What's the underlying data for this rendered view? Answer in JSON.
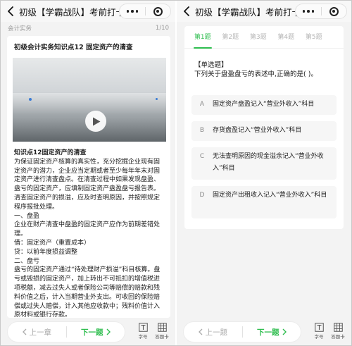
{
  "left": {
    "title": "初级【学霸战队】考前打卡...",
    "subheader": {
      "category": "会计实务",
      "progress": "1/10"
    },
    "card_title": "初级会计实务知识点12 固定资产的清查",
    "content_lines": [
      "知识点12固定资产的清查",
      "为保证固定资产核算的真实性，充分挖掘企业现有固",
      "定资产的潜力，企业应当定期或者至少每年年末对固",
      "定资产进行清查盘点。在清查过程中如果发现盘盈、",
      "盘亏的固定资产，应填制固定资产盘盈盘亏报告表。",
      "清查固定资产的损溢，应及时查明原因，并按照规定",
      "程序报批处理。",
      "一、盘盈",
      "企业在财产清查中盘盈的固定资产应作为前期差错处",
      "理。",
      "借：固定资产（重置成本）",
      "贷：以前年度损益调整",
      "二、盘亏",
      "盘亏的固定资产通过“待处理财产损溢”科目核算。盘",
      "亏或毁损的固定资产，加上转出不可抵扣的增值税进",
      "项税额，减去过失人或者保险公司等赔偿的赔款和残",
      "料价值之后，计入当期营业外支出。可收回的保险赔",
      "偿或过失人赔偿，计入其他应收款中；残料价值计入",
      "原材料或银行存款。"
    ],
    "nav": {
      "prev": "上一章",
      "next": "下一题"
    },
    "tools": {
      "font": "字号",
      "sheet": "答题卡"
    }
  },
  "right": {
    "title": "初级【学霸战队】考前打卡...",
    "tabs": [
      "第1题",
      "第2题",
      "第3题",
      "第4题",
      "第5题"
    ],
    "question_type": "【单选题】",
    "question": "下列关于盘盈盘亏的表述中,正确的是(    )。",
    "options": [
      {
        "letter": "A",
        "text": "固定资产盘盈记入“营业外收入”科目"
      },
      {
        "letter": "B",
        "text": "存货盘盈记入“营业外收入”科目"
      },
      {
        "letter": "C",
        "text": "无法查明原因的现金溢余记入“营业外收入”科目"
      },
      {
        "letter": "D",
        "text": "固定资产出租收入记入“营业外收入”科目"
      }
    ],
    "nav": {
      "prev": "上一题",
      "next": "下一题"
    },
    "tools": {
      "font": "字号",
      "sheet": "答题卡"
    }
  },
  "colors": {
    "accent": "#2ebd4e",
    "muted": "#aaaaaa"
  },
  "icons": [
    "back-icon",
    "more-dots-icon",
    "target-icon",
    "play-icon",
    "chevron-left-icon",
    "chevron-right-icon",
    "font-size-icon",
    "answer-sheet-icon"
  ]
}
